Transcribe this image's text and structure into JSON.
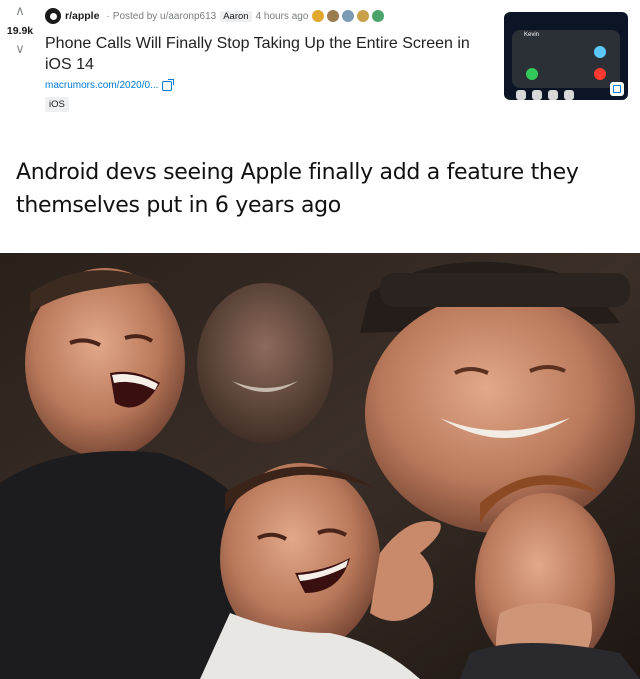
{
  "post": {
    "score": "19.9k",
    "subreddit": "r/apple",
    "posted_by": "Posted by u/aaronp613",
    "flair": "Aaron",
    "time": "4 hours ago",
    "title": "Phone Calls Will Finally Stop Taking Up the Entire Screen in iOS 14",
    "link_text": "macrumors.com/2020/0...",
    "tag": "iOS",
    "thumbnail": {
      "caller_name": "Kevin"
    },
    "award_colors": [
      "#e0a82e",
      "#9c7b4f",
      "#7c9bb5",
      "#c9a04a",
      "#4aa36b"
    ]
  },
  "caption": "Android devs seeing Apple finally add a feature they themselves put in 6 years ago",
  "icons": {
    "upvote": "up-arrow-icon",
    "downvote": "down-arrow-icon",
    "external_link": "external-link-icon",
    "subreddit": "subreddit-icon"
  }
}
